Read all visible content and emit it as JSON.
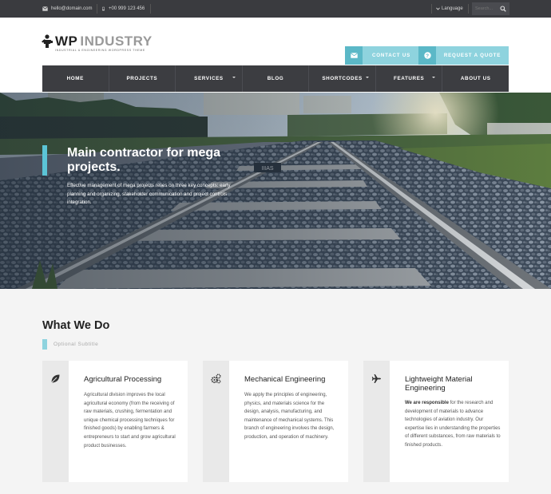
{
  "topbar": {
    "email": "hello@domain.com",
    "phone": "+00 999 123 456",
    "language": "Language",
    "search_placeholder": "Search..."
  },
  "logo": {
    "wp": "WP",
    "industry": "INDUSTRY",
    "tagline": "INDUSTRIAL & ENGINEERING WORDPRESS THEME"
  },
  "cta": {
    "contact": "CONTACT US",
    "quote": "REQUEST A QUOTE"
  },
  "nav": {
    "items": [
      {
        "label": "HOME"
      },
      {
        "label": "PROJECTS"
      },
      {
        "label": "SERVICES"
      },
      {
        "label": "BLOG"
      },
      {
        "label": "SHORTCODES"
      },
      {
        "label": "FEATURES"
      },
      {
        "label": "ABOUT US"
      }
    ]
  },
  "hero": {
    "title": "Main contractor for mega projects.",
    "description": "Effective management of mega projects relies on three key concepts: early planning and organizing, stakeholder communication and project controls integration."
  },
  "section": {
    "title": "What We Do",
    "subtitle": "Optional Subtitle"
  },
  "cards": [
    {
      "icon": "leaf-icon",
      "title": "Agricultural Processing",
      "bold": "",
      "text": "Agricultural division improves the local agricultural economy (from the receiving of raw materials, crushing, fermentation and unique chemical processing techniques for finished goods) by enabling farmers & entrepreneurs to start and grow agricultural product businesses."
    },
    {
      "icon": "gears-icon",
      "title": "Mechanical Engineering",
      "bold": "",
      "text": "We apply the principles of engineering, physics, and materials science for the design, analysis, manufacturing, and maintenance of mechanical systems. This branch of engineering involves the design, production, and operation of machinery."
    },
    {
      "icon": "plane-icon",
      "title": "Lightweight Material Engineering",
      "bold": "We are responsible",
      "text": " for the research and development of materials to advance technologies of aviation industry. Our expertise lies in understanding the properties of different substances, from raw materials to finished products."
    }
  ],
  "colors": {
    "accent": "#5bc4d6",
    "accent_light": "#8ed3de",
    "dark": "#3c3d41"
  }
}
